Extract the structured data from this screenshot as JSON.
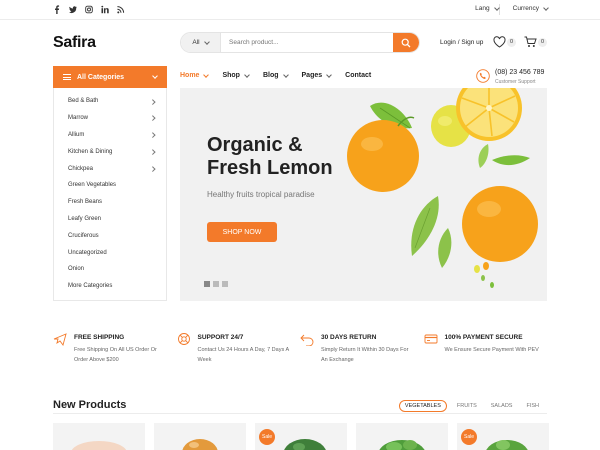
{
  "topbar": {
    "social": [
      "f",
      "t",
      "i",
      "in",
      "rss"
    ],
    "lang": "Lang",
    "currency": "Currency"
  },
  "header": {
    "logo": "Safira",
    "search": {
      "category": "All",
      "placeholder": "Search product..."
    },
    "login": "Login / Sign up",
    "wishlist_count": "0",
    "cart_count": "0"
  },
  "nav": {
    "categories_label": "All Categories",
    "items": [
      {
        "label": "Home",
        "active": true
      },
      {
        "label": "Shop"
      },
      {
        "label": "Blog"
      },
      {
        "label": "Pages"
      },
      {
        "label": "Contact"
      }
    ],
    "phone": "(08) 23 456 789",
    "phone_sub": "Customer Support"
  },
  "categories": [
    {
      "label": "Bed & Bath",
      "arrow": true
    },
    {
      "label": "Marrow",
      "arrow": true
    },
    {
      "label": "Allium",
      "arrow": true
    },
    {
      "label": "Kitchen & Dining",
      "arrow": true
    },
    {
      "label": "Chickpea",
      "arrow": true
    },
    {
      "label": "Green Vegetables",
      "arrow": false
    },
    {
      "label": "Fresh Beans",
      "arrow": false
    },
    {
      "label": "Leafy Green",
      "arrow": false
    },
    {
      "label": "Cruciferous",
      "arrow": false
    },
    {
      "label": "Uncategorized",
      "arrow": false
    },
    {
      "label": "Onion",
      "arrow": false
    },
    {
      "label": "More Categories",
      "arrow": false
    }
  ],
  "hero": {
    "title_line1": "Organic &",
    "title_line2": "Fresh Lemon",
    "subtitle": "Healthy fruits tropical paradise",
    "button": "SHOP NOW"
  },
  "features": [
    {
      "icon": "plane-icon",
      "title": "FREE SHIPPING",
      "desc": "Free Shipping On All US Order Or Order Above $200"
    },
    {
      "icon": "support-icon",
      "title": "SUPPORT 24/7",
      "desc": "Contact Us 24 Hours A Day, 7 Days A Week"
    },
    {
      "icon": "return-icon",
      "title": "30 DAYS RETURN",
      "desc": "Simply Return It Within 30 Days For An Exchange"
    },
    {
      "icon": "card-icon",
      "title": "100% PAYMENT SECURE",
      "desc": "We Ensure Secure Payment With PEV"
    }
  ],
  "new_products": {
    "title": "New Products",
    "tabs": [
      "VEGETABLES",
      "FRUITS",
      "SALADS",
      "FISH"
    ],
    "sale_label": "Sale",
    "cards": [
      {
        "sale": false
      },
      {
        "sale": false
      },
      {
        "sale": true
      },
      {
        "sale": false
      },
      {
        "sale": true
      }
    ]
  },
  "colors": {
    "accent": "#f37a2a",
    "hero_bg": "#f1f1f1",
    "lemon": "#f7a21b"
  }
}
